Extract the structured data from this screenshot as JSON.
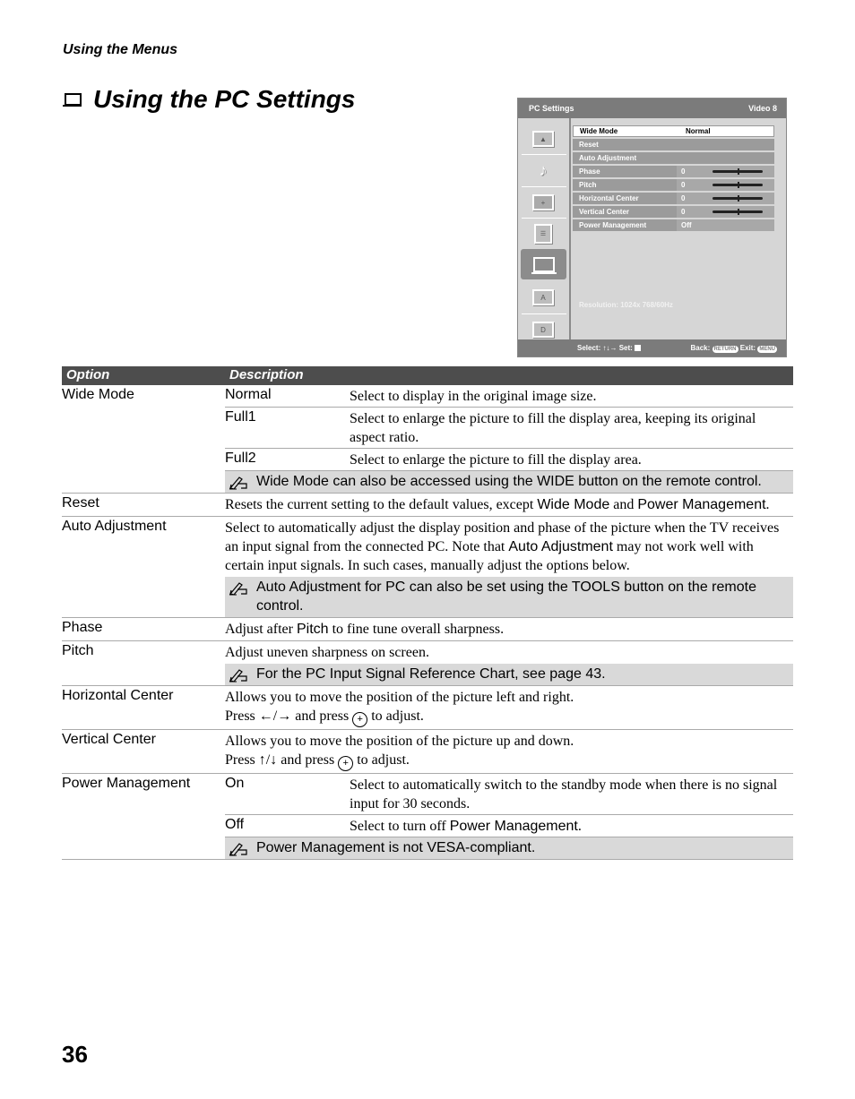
{
  "running_head": "Using the Menus",
  "title": "Using the PC Settings",
  "osd": {
    "header_left": "PC Settings",
    "header_right": "Video 8",
    "side_icons": [
      "picture-icon",
      "sound-icon",
      "screen-icon",
      "setup-icon",
      "pc-icon",
      "analog-channel-icon",
      "digital-channel-icon"
    ],
    "selected_icon": "pc-icon",
    "items": [
      {
        "label": "Wide Mode",
        "value": "Normal",
        "highlighted": true,
        "slider": false
      },
      {
        "label": "Reset",
        "value": "",
        "highlighted": false,
        "slider": false
      },
      {
        "label": "Auto Adjustment",
        "value": "",
        "highlighted": false,
        "slider": false
      },
      {
        "label": "Phase",
        "value": "0",
        "highlighted": false,
        "slider": true,
        "slider_position": 0.5
      },
      {
        "label": "Pitch",
        "value": "0",
        "highlighted": false,
        "slider": true,
        "slider_position": 0.5
      },
      {
        "label": "Horizontal Center",
        "value": "0",
        "highlighted": false,
        "slider": true,
        "slider_position": 0.5
      },
      {
        "label": "Vertical Center",
        "value": "0",
        "highlighted": false,
        "slider": true,
        "slider_position": 0.5
      },
      {
        "label": "Power Management",
        "value": "Off",
        "highlighted": false,
        "slider": false
      }
    ],
    "resolution": "Resolution: 1024x 768/60Hz",
    "footer_select": "Select:",
    "footer_select_arrows": "↑↓→",
    "footer_set": "Set:",
    "footer_back": "Back:",
    "footer_back_btn": "RETURN",
    "footer_exit": "Exit:",
    "footer_exit_btn": "MENU"
  },
  "table": {
    "header_option": "Option",
    "header_description": "Description",
    "wide_mode": {
      "option": "Wide Mode",
      "subs": [
        {
          "key": "Normal",
          "text": "Select to display in the original image size."
        },
        {
          "key": "Full1",
          "text": "Select to enlarge the picture to fill the display area, keeping its original aspect ratio."
        },
        {
          "key": "Full2",
          "text": "Select to enlarge the picture to fill the display area."
        }
      ],
      "note": "Wide Mode can also be accessed using the WIDE button on the remote control."
    },
    "reset": {
      "option": "Reset",
      "text_a": "Resets the current setting to the default values, except ",
      "term1": "Wide Mode",
      "text_b": " and ",
      "term2": "Power Management",
      "text_c": "."
    },
    "auto_adjustment": {
      "option": "Auto Adjustment",
      "text_a": "Select to automatically adjust the display position and phase of the picture when the TV receives an input signal from the connected PC. Note that ",
      "term": "Auto Adjustment",
      "text_b": " may not work well with certain input signals. In such cases, manually adjust the options below.",
      "note": "Auto Adjustment for PC can also be set using the TOOLS button on the remote control."
    },
    "phase": {
      "option": "Phase",
      "text_a": "Adjust after ",
      "term": "Pitch",
      "text_b": " to fine tune overall sharpness."
    },
    "pitch": {
      "option": "Pitch",
      "text": "Adjust uneven sharpness on screen.",
      "note": "For the PC Input Signal Reference Chart, see page 43."
    },
    "horizontal_center": {
      "option": "Horizontal Center",
      "line1": "Allows you to move the position of the picture left and right.",
      "press": "Press ",
      "arrows": "←/→",
      "and_press": " and press ",
      "to_adjust": " to adjust."
    },
    "vertical_center": {
      "option": "Vertical Center",
      "line1": "Allows you to move the position of the picture up and down.",
      "press": "Press ",
      "arrows": "↑/↓",
      "and_press": " and press ",
      "to_adjust": " to adjust."
    },
    "power_management": {
      "option": "Power Management",
      "subs": [
        {
          "key": "On",
          "text": "Select to automatically switch to the standby mode when there is no signal input for 30 seconds."
        }
      ],
      "off_key": "Off",
      "off_text_a": "Select to turn off ",
      "off_term": "Power Management",
      "off_text_b": ".",
      "note": "Power Management is not VESA-compliant."
    }
  },
  "page_number": "36"
}
